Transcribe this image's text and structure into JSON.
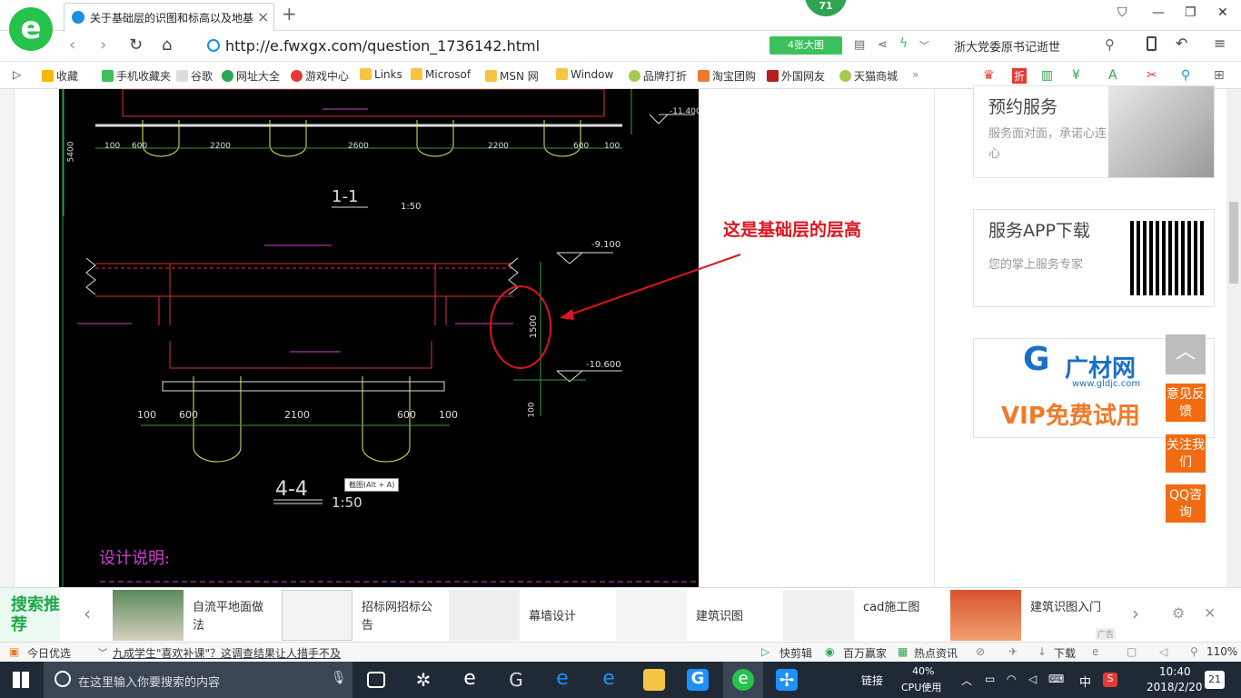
{
  "browser": {
    "badge_count": "71",
    "tab_title": "关于基础层的识图和标高以及地基",
    "url": "http://e.fwxgx.com/question_1736142.html",
    "big_image_btn": "4张大图",
    "news_ticker": "浙大党委原书记逝世"
  },
  "bookmarks": [
    "收藏",
    "手机收藏夹",
    "谷歌",
    "网址大全",
    "游戏中心",
    "Links",
    "Microsof",
    "MSN 网",
    "Window",
    "品牌打折",
    "淘宝团购",
    "外国网友",
    "天猫商城"
  ],
  "cad": {
    "section_label_1": "1-1",
    "scale_1": "1:50",
    "section_label_2": "4-4",
    "scale_2": "1:50",
    "dims_top": [
      "100",
      "600",
      "2200",
      "2600",
      "2200",
      "600",
      "100"
    ],
    "dims_bottom": [
      "100",
      "600",
      "2100",
      "600",
      "100"
    ],
    "elev_1": "-11.400",
    "elev_2": "-9.100",
    "elev_3": "-10.600",
    "height_dim": "1500",
    "left_height": "5400",
    "dim_100": "100",
    "tooltip": "截图(Alt + A)",
    "design_note": "设计说明:"
  },
  "annotation": "这是基础层的层高",
  "right_cards": [
    {
      "title": "预约服务",
      "desc": "服务面对面，承诺心连心"
    },
    {
      "title": "服务APP下载",
      "desc": "您的掌上服务专家"
    },
    {
      "brand": "广材网",
      "site": "www.gldjc.com",
      "promo": "VIP免费试用"
    }
  ],
  "side_buttons": [
    "意见反馈",
    "关注我们",
    "QQ咨询"
  ],
  "recommend": {
    "title": "搜索推荐",
    "items": [
      "自流平地面做法",
      "招标网招标公告",
      "幕墙设计",
      "建筑识图",
      "cad施工图",
      "建筑识图入门"
    ],
    "ad_label": "广告"
  },
  "status": {
    "today": "今日优选",
    "headline": "九成学生\"喜欢补课\"？这调查结果让人措手不及",
    "items": [
      "快剪辑",
      "百万赢家",
      "热点资讯",
      "下载"
    ],
    "zoom": "110%"
  },
  "taskbar": {
    "search_placeholder": "在这里输入你要搜索的内容",
    "link_label": "链接",
    "cpu": "40%",
    "cpu_label": "CPU使用",
    "ime": "中",
    "time": "10:40",
    "date": "2018/2/20",
    "notif_count": "21"
  }
}
